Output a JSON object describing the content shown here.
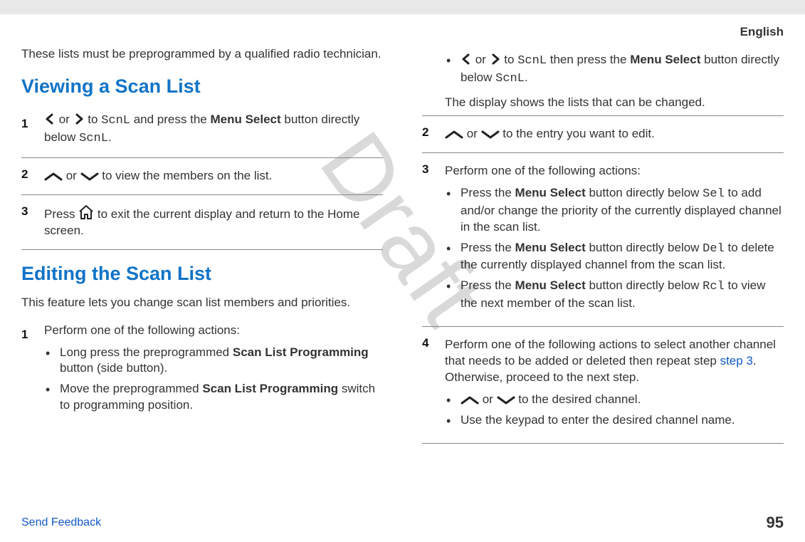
{
  "header": {
    "language": "English"
  },
  "watermark": "Draft",
  "left": {
    "intro": "These lists must be preprogrammed by a qualified radio technician.",
    "section1": {
      "title": "Viewing a Scan List",
      "step1": {
        "t1": " or ",
        "t2": " to ",
        "mono1": "ScnL",
        "t3": " and press the ",
        "bold1": "Menu Select",
        "t4": " button directly below ",
        "mono2": "ScnL",
        "t5": "."
      },
      "step2": {
        "t1": " or ",
        "t2": " to view the members on the list."
      },
      "step3": {
        "t1": "Press ",
        "t2": " to exit the current display and return to the Home screen."
      }
    },
    "section2": {
      "title": "Editing the Scan List",
      "intro": "This feature lets you change scan list members and priorities.",
      "step1": {
        "text": "Perform one of the following actions:",
        "b1a": "Long press the preprogrammed ",
        "b1b": "Scan List Programming",
        "b1c": " button (side button).",
        "b2a": "Move the preprogrammed ",
        "b2b": "Scan List Programming",
        "b2c": " switch to programming position."
      }
    }
  },
  "right": {
    "cont_bullet": {
      "t1": " or ",
      "t2": " to ",
      "mono1": "ScnL",
      "t3": " then press the ",
      "bold1": "Menu Select",
      "t4": " button directly below ",
      "mono2": "ScnL",
      "t5": "."
    },
    "after": "The display shows the lists that can be changed.",
    "step2": {
      "t1": " or ",
      "t2": " to the entry you want to edit."
    },
    "step3": {
      "text": "Perform one of the following actions:",
      "b1a": "Press the ",
      "b1b": "Menu Select",
      "b1c": " button directly below ",
      "b1m": "Sel",
      "b1d": " to add and/or change the priority of the currently displayed channel in the scan list.",
      "b2a": "Press the ",
      "b2b": "Menu Select",
      "b2c": " button directly below ",
      "b2m": "Del",
      "b2d": " to delete the currently displayed channel from the scan list.",
      "b3a": "Press the ",
      "b3b": "Menu Select",
      "b3c": " button directly below ",
      "b3m": "Rcl",
      "b3d": " to view the next member of the scan list."
    },
    "step4": {
      "t1": "Perform one of the following actions to select another channel that needs to be added or deleted then repeat step ",
      "link": "step 3",
      "t2": ". Otherwise, proceed to the next step.",
      "b1a": " or ",
      "b1b": " to the desired channel.",
      "b2": "Use the keypad to enter the desired channel name."
    }
  },
  "footer": {
    "send": "Send Feedback",
    "page": "95"
  }
}
